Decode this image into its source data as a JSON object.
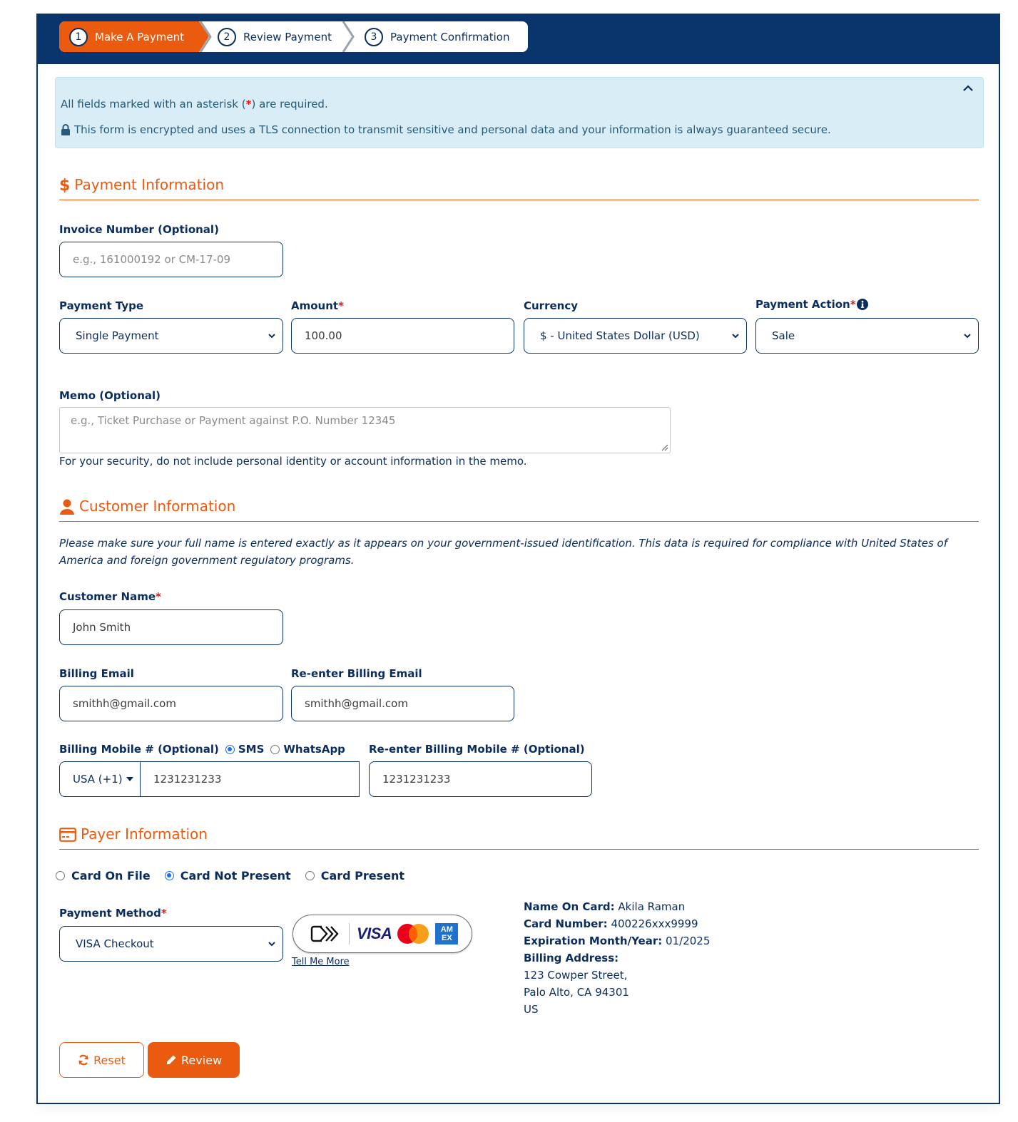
{
  "colors": {
    "navy": "#0a346c",
    "accent": "#ea5b10",
    "info_bg": "#d9edf6",
    "required": "#e4171c",
    "radio_on": "#1a6ee8"
  },
  "stepper": {
    "steps": [
      {
        "number": "1",
        "label": "Make A Payment",
        "active": true
      },
      {
        "number": "2",
        "label": "Review Payment",
        "active": false
      },
      {
        "number": "3",
        "label": "Payment Confirmation",
        "active": false
      }
    ]
  },
  "notice": {
    "required_prefix": "All fields marked with an asterisk (",
    "required_asterisk": "*",
    "required_suffix": ") are required.",
    "secure_text": "This form is encrypted and uses a TLS connection to transmit sensitive and personal data and your information is always guaranteed secure.",
    "lock_icon": "lock-icon",
    "collapse_icon": "chevron-up-icon"
  },
  "payment_info": {
    "title": "Payment Information",
    "icon": "dollar-icon",
    "invoice": {
      "label": "Invoice Number (Optional)",
      "value": "",
      "placeholder": "e.g., 161000192 or CM-17-09"
    },
    "payment_type": {
      "label": "Payment Type",
      "selected": "Single Payment"
    },
    "amount": {
      "label": "Amount",
      "required": "*",
      "value": "100.00"
    },
    "currency": {
      "label": "Currency",
      "selected": "$ - United States Dollar (USD)"
    },
    "payment_action": {
      "label": "Payment Action",
      "required": "*",
      "selected": "Sale",
      "info_icon": "info-circle-icon"
    },
    "memo": {
      "label": "Memo (Optional)",
      "value": "",
      "placeholder": "e.g., Ticket Purchase or Payment against P.O. Number 12345"
    },
    "memo_help": "For your security, do not include personal identity or account information in the memo."
  },
  "customer_info": {
    "title": "Customer Information",
    "icon": "user-icon",
    "notice": "Please make sure your full name is entered exactly as it appears on your government-issued identification. This data is required for compliance with United States of America and foreign government regulatory programs.",
    "customer_name": {
      "label": "Customer Name",
      "required": "*",
      "value": "John Smith"
    },
    "billing_email": {
      "label": "Billing Email",
      "value": "smithh@gmail.com"
    },
    "reenter_email": {
      "label": "Re-enter Billing Email",
      "value": "smithh@gmail.com"
    },
    "billing_mobile": {
      "label": "Billing Mobile # (Optional)",
      "channel_options": [
        {
          "label": "SMS",
          "checked": true
        },
        {
          "label": "WhatsApp",
          "checked": false
        }
      ],
      "country_code": "USA (+1)",
      "value": "1231231233"
    },
    "reenter_mobile": {
      "label": "Re-enter Billing Mobile # (Optional)",
      "value": "1231231233"
    }
  },
  "payer_info": {
    "title": "Payer Information",
    "icon": "credit-card-icon",
    "card_modes": [
      {
        "label": "Card On File",
        "checked": false
      },
      {
        "label": "Card Not Present",
        "checked": true
      },
      {
        "label": "Card Present",
        "checked": false
      }
    ],
    "payment_method": {
      "label": "Payment Method",
      "required": "*",
      "selected": "VISA Checkout"
    },
    "card_brands": {
      "visa": "VISA",
      "amex_top": "AM",
      "amex_bottom": "EX"
    },
    "tell_me_more": "Tell Me More",
    "card_details": {
      "name_label": "Name On Card:",
      "name_value": "Akila Raman",
      "number_label": "Card Number:",
      "number_value": "400226xxx9999",
      "expiry_label": "Expiration Month/Year:",
      "expiry_value": "01/2025",
      "address_label": "Billing Address:",
      "address_line1": "123 Cowper Street,",
      "address_line2": "Palo Alto, CA 94301",
      "address_line3": "US"
    }
  },
  "actions": {
    "reset_label": "Reset",
    "review_label": "Review"
  }
}
